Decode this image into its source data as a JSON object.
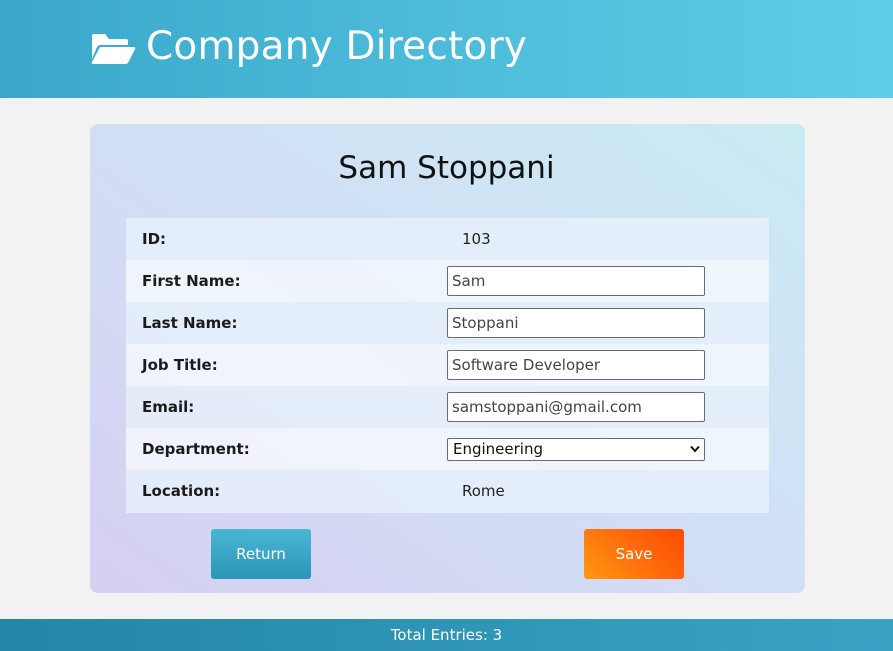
{
  "header": {
    "title": "Company Directory",
    "icon": "folder-open-icon"
  },
  "employee": {
    "name": "Sam Stoppani",
    "fields": {
      "id": {
        "label": "ID:",
        "value": "103"
      },
      "first_name": {
        "label": "First Name:",
        "value": "Sam"
      },
      "last_name": {
        "label": "Last Name:",
        "value": "Stoppani"
      },
      "job_title": {
        "label": "Job Title:",
        "value": "Software Developer"
      },
      "email": {
        "label": "Email:",
        "value": "samstoppani@gmail.com"
      },
      "department": {
        "label": "Department:",
        "value": "Engineering"
      },
      "location": {
        "label": "Location:",
        "value": "Rome"
      }
    }
  },
  "actions": {
    "return_label": "Return",
    "save_label": "Save"
  },
  "footer": {
    "total_entries": "Total Entries: 3"
  },
  "colors": {
    "header_accent": "#4fbedb",
    "return_button": "#2b97b8",
    "save_button": "#ff6a0c",
    "footer": "#2486a6"
  }
}
